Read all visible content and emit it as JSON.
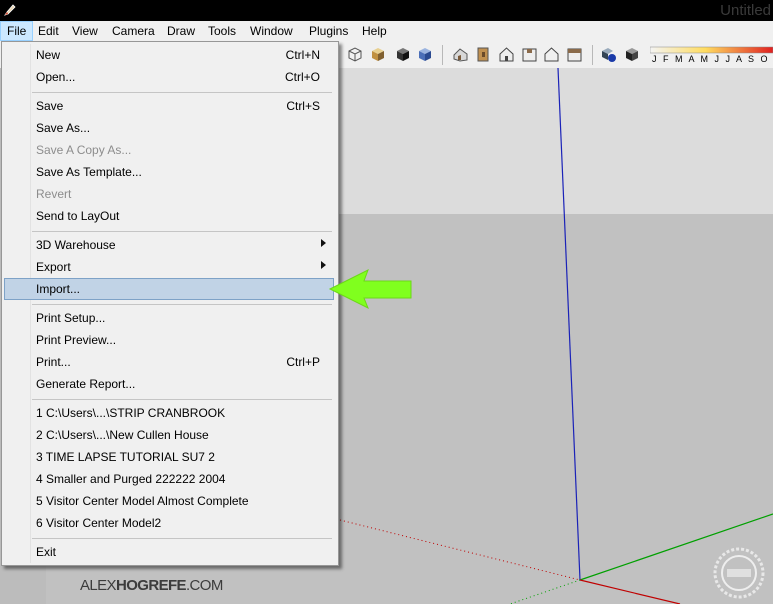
{
  "window": {
    "title": "Untitled"
  },
  "menubar": {
    "items": [
      "File",
      "Edit",
      "View",
      "Camera",
      "Draw",
      "Tools",
      "Window",
      "Plugins",
      "Help"
    ]
  },
  "toolbar": {
    "shadow_months": "J F M A M J J A S O N"
  },
  "file_menu": {
    "new": {
      "label": "New",
      "shortcut": "Ctrl+N"
    },
    "open": {
      "label": "Open...",
      "shortcut": "Ctrl+O"
    },
    "save": {
      "label": "Save",
      "shortcut": "Ctrl+S"
    },
    "save_as": {
      "label": "Save As..."
    },
    "save_copy_as": {
      "label": "Save A Copy As..."
    },
    "save_as_template": {
      "label": "Save As Template..."
    },
    "revert": {
      "label": "Revert"
    },
    "send_to_layout": {
      "label": "Send to LayOut"
    },
    "warehouse": {
      "label": "3D Warehouse"
    },
    "export": {
      "label": "Export"
    },
    "import": {
      "label": "Import..."
    },
    "print_setup": {
      "label": "Print Setup..."
    },
    "print_preview": {
      "label": "Print Preview..."
    },
    "print": {
      "label": "Print...",
      "shortcut": "Ctrl+P"
    },
    "generate_report": {
      "label": "Generate Report..."
    },
    "recent": [
      "1 C:\\Users\\...\\STRIP CRANBROOK",
      "2 C:\\Users\\...\\New Cullen House",
      "3 TIME LAPSE TUTORIAL SU7 2",
      "4 Smaller and Purged 222222 2004",
      "5 Visitor Center Model Almost Complete",
      "6 Visitor Center Model2"
    ],
    "exit": {
      "label": "Exit"
    }
  },
  "branding": {
    "part1": "ALEX",
    "part2": "HOGREFE",
    "part3": ".COM"
  },
  "colors": {
    "axis_blue": "#1a22b8",
    "axis_red": "#c00000",
    "axis_green": "#00a000",
    "highlight": "#c1d3e6",
    "arrow": "#80ff1e"
  },
  "icons": [
    "pencil-app-icon",
    "green-pointer-arrow",
    "watermark-seal-icon"
  ]
}
